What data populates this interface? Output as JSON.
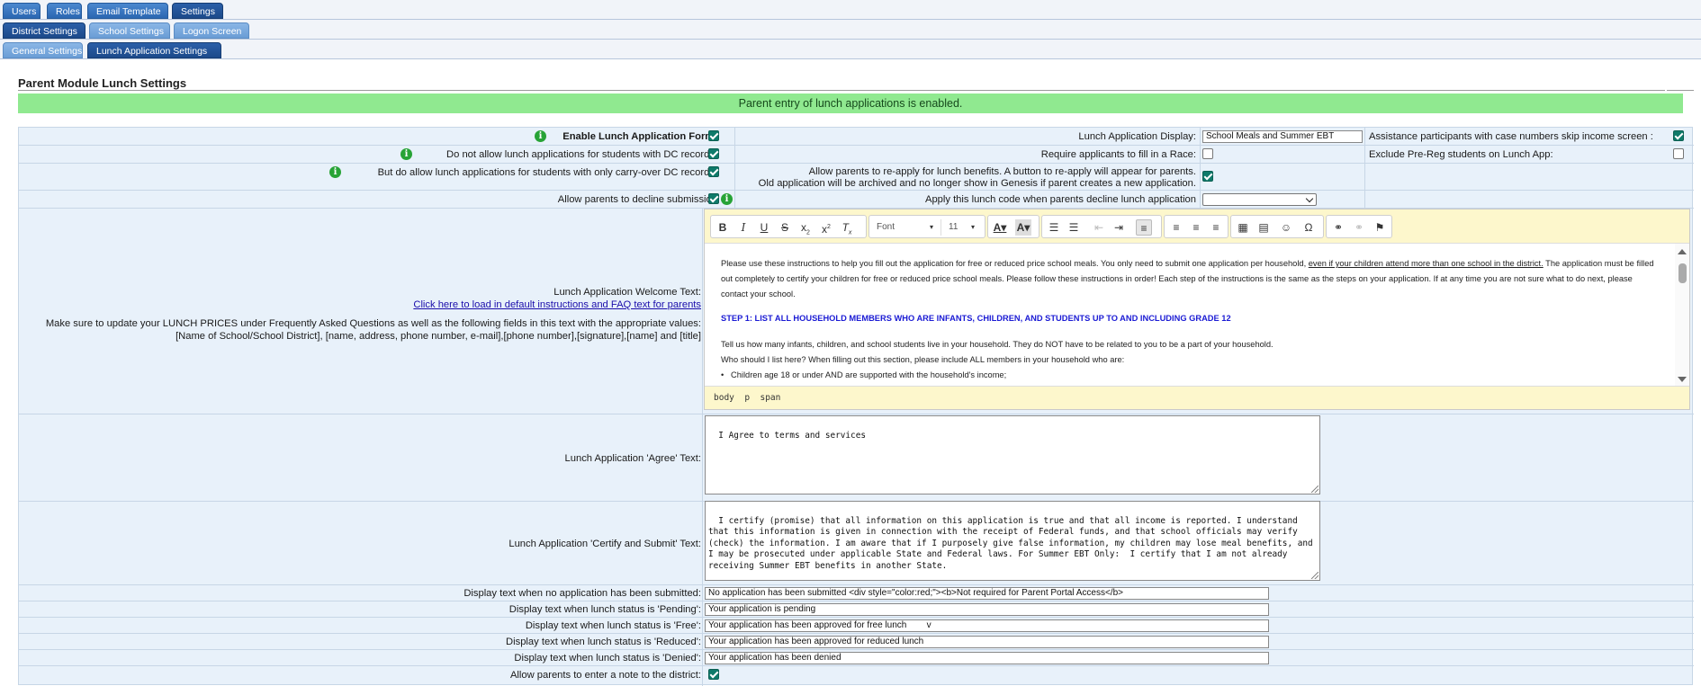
{
  "tabs_row1": [
    {
      "label": "Users"
    },
    {
      "label": "Roles"
    },
    {
      "label": "Email Template"
    },
    {
      "label": "Settings"
    }
  ],
  "tabs_row2": [
    {
      "label": "District Settings"
    },
    {
      "label": "School Settings"
    },
    {
      "label": "Logon Screen"
    }
  ],
  "tabs_row3": [
    {
      "label": "General Settings"
    },
    {
      "label": "Lunch Application Settings"
    }
  ],
  "panel": {
    "title": "Parent Module Lunch Settings",
    "banner": "Parent entry of lunch applications is enabled."
  },
  "settings": {
    "enable_form": {
      "label": "Enable Lunch Application Form:",
      "checked": true
    },
    "no_dc": {
      "label": "Do not allow lunch applications for students with DC records:",
      "checked": true
    },
    "carry_over_dc": {
      "label": "But do allow lunch applications for students with only carry-over DC records:",
      "checked": true
    },
    "decline": {
      "label": "Allow parents to decline submission",
      "checked": true
    },
    "display": {
      "label": "Lunch Application Display:",
      "value": "School Meals and Summer EBT"
    },
    "race": {
      "label": "Require applicants to fill in a Race:",
      "checked": false
    },
    "reapply_line1": "Allow parents to re-apply for lunch benefits. A button to re-apply will appear for parents.",
    "reapply_line2": "Old application will be archived and no longer show in Genesis if parent creates a new application.",
    "reapply_checked": true,
    "decline_code": {
      "label": "Apply this lunch code when parents decline lunch application",
      "value": ""
    },
    "assistance": {
      "label": "Assistance participants with case numbers skip income screen :",
      "checked": true
    },
    "exclude_prereg": {
      "label": "Exclude Pre-Reg students on Lunch App:",
      "checked": false
    }
  },
  "welcome": {
    "label": "Lunch Application Welcome Text:",
    "link": "Click here to load in default instructions and FAQ text for parents",
    "note_line1": "Make sure to update your LUNCH PRICES under Frequently Asked Questions as well as the following fields in this text with the appropriate values:",
    "note_line2": "[Name of School/School District], [name, address, phone number, e-mail],[phone number],[signature],[name] and [title]"
  },
  "editor": {
    "font_label": "Font",
    "size_label": "11",
    "para1_a": "Please use these instructions to help you fill out the application for free or reduced price school meals. You only need to submit one application per household, ",
    "para1_u": "even if your children attend more than one school in the district.",
    "para1_b": " The application must be filled out completely to certify your children for free or reduced price school meals. Please follow these instructions in order! Each step of the instructions is the same as the steps on your application. If at any time you are not sure what to do next, please contact your school.",
    "step1": "STEP 1: LIST ALL HOUSEHOLD MEMBERS WHO ARE INFANTS, CHILDREN, AND STUDENTS UP TO AND INCLUDING GRADE 12",
    "para2": "Tell us how many infants, children, and school students live in your household. They do NOT have to be related to you to be a part of your household.",
    "para3": "Who should I list here? When filling out this section, please include ALL members in your household who are:",
    "bullet1": "Children age 18 or under AND are supported with the household's income;",
    "path": "body  p  span"
  },
  "agree": {
    "label": "Lunch Application 'Agree' Text:",
    "value": "I Agree to terms and services"
  },
  "certify": {
    "label": "Lunch Application 'Certify and Submit' Text:",
    "value": "I certify (promise) that all information on this application is true and that all income is reported. I understand that this information is given in connection with the receipt of Federal funds, and that school officials may verify (check) the information. I am aware that if I purposely give false information, my children may lose meal benefits, and I may be prosecuted under applicable State and Federal laws. For Summer EBT Only:  I certify that I am not already receiving Summer EBT benefits in another State."
  },
  "status_texts": [
    {
      "label": "Display text when no application has been submitted:",
      "value": "No application has been submitted <div style=\"color:red;\"><b>Not required for Parent Portal Access</b>"
    },
    {
      "label": "Display text when lunch status is 'Pending':",
      "value": "Your application is pending"
    },
    {
      "label": "Display text when lunch status is 'Free':",
      "value": "Your application has been approved for free lunch        v"
    },
    {
      "label": "Display text when lunch status is 'Reduced':",
      "value": "Your application has been approved for reduced lunch"
    },
    {
      "label": "Display text when lunch status is 'Denied':",
      "value": "Your application has been denied"
    }
  ],
  "note_to_district": {
    "label": "Allow parents to enter a note to the district:",
    "checked": true
  }
}
